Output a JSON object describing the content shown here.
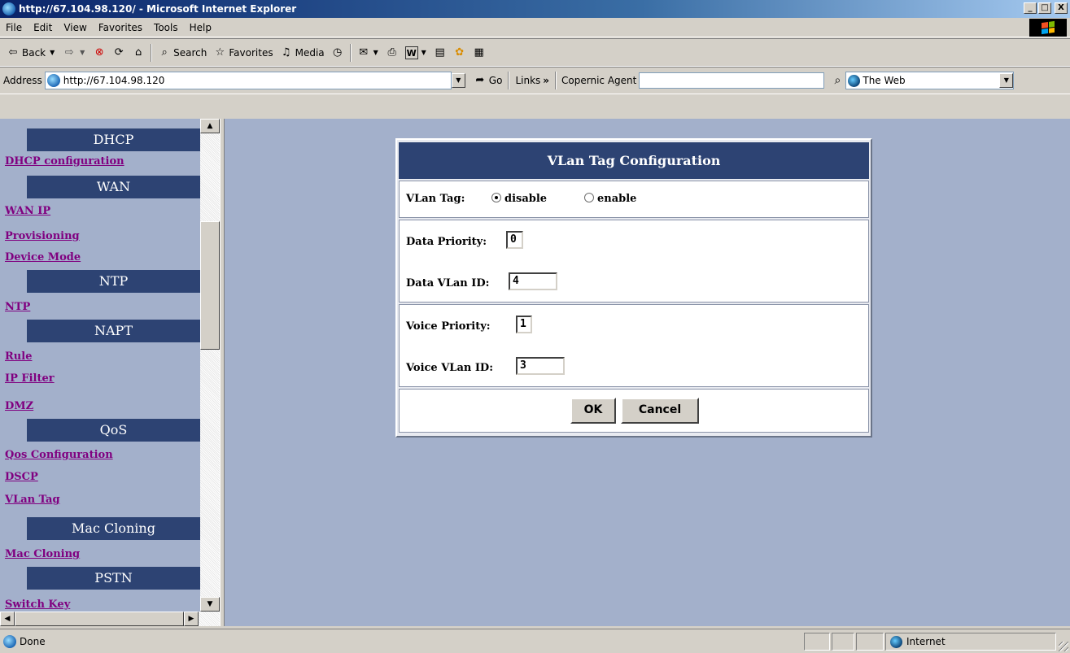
{
  "window": {
    "title": "http://67.104.98.120/ - Microsoft Internet Explorer",
    "minimize": "_",
    "maximize": "□",
    "close": "X"
  },
  "menu": [
    "File",
    "Edit",
    "View",
    "Favorites",
    "Tools",
    "Help"
  ],
  "toolbar": {
    "back": "Back",
    "search": "Search",
    "favorites": "Favorites",
    "media": "Media"
  },
  "address": {
    "label": "Address",
    "url": "http://67.104.98.120",
    "go": "Go",
    "links": "Links",
    "links_chevron": "»",
    "copernic": "Copernic Agent",
    "search_value": "",
    "web_select": "The Web"
  },
  "nav": {
    "headers": [
      "DHCP",
      "WAN",
      "NTP",
      "NAPT",
      "QoS",
      "Mac Cloning",
      "PSTN"
    ],
    "links": [
      "DHCP configuration",
      "WAN IP",
      "Provisioning",
      "Device Mode",
      "NTP",
      "Rule",
      "IP Filter",
      "DMZ",
      "Qos Configuration",
      "DSCP",
      "VLan Tag",
      "Mac Cloning",
      "Switch Key"
    ]
  },
  "form": {
    "title": "VLan Tag Configuration",
    "vlan_tag_label": "VLan Tag:",
    "disable_label": "disable",
    "enable_label": "enable",
    "vlan_tag_selected": "disable",
    "data_priority_label": "Data Priority:",
    "data_priority_value": "0",
    "data_vlan_label": "Data VLan ID:",
    "data_vlan_value": "4",
    "voice_priority_label": "Voice Priority:",
    "voice_priority_value": "1",
    "voice_vlan_label": "Voice VLan ID:",
    "voice_vlan_value": "3",
    "ok": "OK",
    "cancel": "Cancel"
  },
  "status": {
    "text": "Done",
    "zone": "Internet"
  },
  "colors": {
    "nav_header_bg": "#2d4373",
    "page_bg": "#a3b0cb",
    "link_visited": "#800080"
  }
}
